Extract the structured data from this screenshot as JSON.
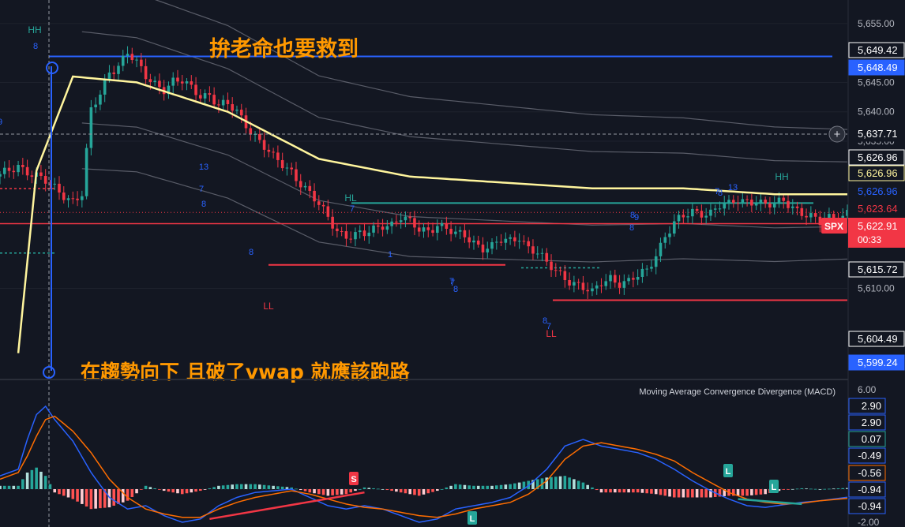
{
  "annotations": {
    "top_text": "拚老命也要救到",
    "bottom_text": "在趨勢向下 且破了vwap 就應該跑路"
  },
  "markers": {
    "hh_left": "HH",
    "hh_right": "HH",
    "hl": "HL",
    "ll_left": "LL",
    "ll_right": "LL",
    "seq": [
      "8",
      "13",
      "7",
      "8",
      "7",
      "8",
      "7",
      "1",
      "8",
      "7",
      "8",
      "7",
      "8",
      "9",
      "8",
      "13",
      "7",
      "8",
      "9"
    ]
  },
  "symbol": {
    "ticker": "SPX",
    "price": "5,622.91",
    "countdown": "00:33"
  },
  "price_axis": {
    "ticks": [
      "5,655.00",
      "5,645.00",
      "5,640.00",
      "5,635.00",
      "5,610.00"
    ],
    "labels": [
      {
        "text": "5,649.42",
        "value": 5649.42,
        "bg": "#131722",
        "fg": "#ffffff",
        "border": "#ffffff"
      },
      {
        "text": "5,648.49",
        "value": 5648.49,
        "bg": "#2962ff",
        "fg": "#ffffff",
        "border": "#2962ff"
      },
      {
        "text": "5,637.71",
        "value": 5637.71,
        "bg": "#131722",
        "fg": "#ffffff",
        "border": "#131722"
      },
      {
        "text": "5,626.96",
        "value": 5626.96,
        "bg": "#131722",
        "fg": "#ffffff",
        "border": "#ffffff"
      },
      {
        "text": "5,626.96",
        "value": 5626.96,
        "bg": "#131722",
        "fg": "#fff59d",
        "border": "#fff59d"
      },
      {
        "text": "5,626.96",
        "value": 5626.96,
        "bg": "#131722",
        "fg": "#2962ff",
        "border": "#131722"
      },
      {
        "text": "5,623.64",
        "value": 5623.64,
        "bg": "#131722",
        "fg": "#f23645",
        "border": "#131722"
      },
      {
        "text": "5,615.72",
        "value": 5615.72,
        "bg": "#131722",
        "fg": "#ffffff",
        "border": "#ffffff"
      },
      {
        "text": "5,604.49",
        "value": 5604.49,
        "bg": "#131722",
        "fg": "#ffffff",
        "border": "#ffffff"
      },
      {
        "text": "5,599.24",
        "value": 5599.24,
        "bg": "#2962ff",
        "fg": "#ffffff",
        "border": "#2962ff"
      }
    ]
  },
  "macd": {
    "title": "Moving Average Convergence Divergence (MACD)",
    "ticks": [
      "6.00",
      "-2.00"
    ],
    "labels": [
      {
        "text": "2.90",
        "fg": "#2962ff"
      },
      {
        "text": "2.90",
        "fg": "#2962ff"
      },
      {
        "text": "0.07",
        "fg": "#26a69a"
      },
      {
        "text": "-0.49",
        "fg": "#2962ff"
      },
      {
        "text": "-0.56",
        "fg": "#ff6d00"
      },
      {
        "text": "-0.94",
        "fg": "#2962ff"
      },
      {
        "text": "-0.94",
        "fg": "#2962ff"
      }
    ],
    "badges": [
      "L",
      "L",
      "L",
      "S"
    ]
  },
  "colors": {
    "background": "#131722",
    "up": "#26a69a",
    "down": "#f23645",
    "vwap": "#fff59d",
    "blue": "#2962ff",
    "annotation": "#ff9800",
    "band": "#787b86"
  },
  "chart_data": {
    "type": "candlestick",
    "y_range": [
      5596,
      5659
    ],
    "macd_range": [
      -2,
      6
    ],
    "close_path": [
      [
        0,
        5629
      ],
      [
        2,
        5630
      ],
      [
        4,
        5631
      ],
      [
        6,
        5630
      ],
      [
        8,
        5629
      ],
      [
        10,
        5628
      ],
      [
        12,
        5627
      ],
      [
        14,
        5626
      ],
      [
        16,
        5625
      ],
      [
        18,
        5626
      ],
      [
        20,
        5640
      ],
      [
        22,
        5643
      ],
      [
        24,
        5647
      ],
      [
        26,
        5648
      ],
      [
        28,
        5650
      ],
      [
        30,
        5648
      ],
      [
        32,
        5646
      ],
      [
        34,
        5645
      ],
      [
        36,
        5644
      ],
      [
        38,
        5645
      ],
      [
        40,
        5645
      ],
      [
        42,
        5644
      ],
      [
        44,
        5643
      ],
      [
        46,
        5643
      ],
      [
        48,
        5641
      ],
      [
        50,
        5641
      ],
      [
        52,
        5640
      ],
      [
        54,
        5638
      ],
      [
        56,
        5636
      ],
      [
        58,
        5634
      ],
      [
        60,
        5632
      ],
      [
        62,
        5631
      ],
      [
        64,
        5630
      ],
      [
        66,
        5628
      ],
      [
        68,
        5626
      ],
      [
        70,
        5624
      ],
      [
        72,
        5622
      ],
      [
        74,
        5620
      ],
      [
        76,
        5619
      ],
      [
        78,
        5619
      ],
      [
        80,
        5619
      ],
      [
        82,
        5620
      ],
      [
        84,
        5621
      ],
      [
        86,
        5621
      ],
      [
        88,
        5622
      ],
      [
        90,
        5621
      ],
      [
        92,
        5620
      ],
      [
        94,
        5620
      ],
      [
        96,
        5621
      ],
      [
        98,
        5620
      ],
      [
        100,
        5619
      ],
      [
        102,
        5619
      ],
      [
        104,
        5618
      ],
      [
        106,
        5617
      ],
      [
        108,
        5617
      ],
      [
        110,
        5618
      ],
      [
        112,
        5618
      ],
      [
        114,
        5619
      ],
      [
        116,
        5617
      ],
      [
        118,
        5616
      ],
      [
        120,
        5614
      ],
      [
        122,
        5613
      ],
      [
        124,
        5612
      ],
      [
        126,
        5611
      ],
      [
        128,
        5610
      ],
      [
        130,
        5609
      ],
      [
        132,
        5611
      ],
      [
        134,
        5612
      ],
      [
        136,
        5611
      ],
      [
        138,
        5611
      ],
      [
        140,
        5612
      ],
      [
        142,
        5613
      ],
      [
        144,
        5616
      ],
      [
        146,
        5619
      ],
      [
        148,
        5621
      ],
      [
        150,
        5622
      ],
      [
        152,
        5623
      ],
      [
        154,
        5623
      ],
      [
        156,
        5623
      ],
      [
        158,
        5624
      ],
      [
        160,
        5624
      ],
      [
        162,
        5625
      ],
      [
        164,
        5625
      ],
      [
        166,
        5625
      ],
      [
        168,
        5624
      ],
      [
        170,
        5624
      ],
      [
        172,
        5625
      ],
      [
        174,
        5624
      ],
      [
        176,
        5623
      ],
      [
        178,
        5622
      ],
      [
        180,
        5621
      ],
      [
        182,
        5622
      ],
      [
        184,
        5622
      ],
      [
        186,
        5623
      ]
    ],
    "vwap_path": [
      [
        4,
        5599
      ],
      [
        8,
        5630
      ],
      [
        16,
        5646
      ],
      [
        30,
        5645
      ],
      [
        50,
        5640
      ],
      [
        70,
        5632
      ],
      [
        90,
        5629
      ],
      [
        110,
        5628
      ],
      [
        130,
        5627
      ],
      [
        150,
        5627
      ],
      [
        170,
        5626
      ],
      [
        186,
        5626
      ]
    ],
    "macd_path": [
      [
        0,
        0.8
      ],
      [
        4,
        1.2
      ],
      [
        6,
        3.0
      ],
      [
        8,
        4.5
      ],
      [
        10,
        5.0
      ],
      [
        12,
        4.2
      ],
      [
        16,
        2.9
      ],
      [
        20,
        1.0
      ],
      [
        24,
        -0.5
      ],
      [
        28,
        -1.2
      ],
      [
        32,
        -1.0
      ],
      [
        36,
        -1.6
      ],
      [
        40,
        -2.0
      ],
      [
        44,
        -1.8
      ],
      [
        48,
        -1.0
      ],
      [
        52,
        -0.5
      ],
      [
        56,
        -0.2
      ],
      [
        60,
        -0.1
      ],
      [
        64,
        0.0
      ],
      [
        68,
        -0.5
      ],
      [
        72,
        -1.0
      ],
      [
        76,
        -1.2
      ],
      [
        80,
        -1.0
      ],
      [
        84,
        -1.2
      ],
      [
        88,
        -1.6
      ],
      [
        92,
        -2.0
      ],
      [
        96,
        -1.8
      ],
      [
        100,
        -1.2
      ],
      [
        104,
        -1.0
      ],
      [
        108,
        -0.8
      ],
      [
        112,
        -0.5
      ],
      [
        116,
        0.2
      ],
      [
        120,
        1.2
      ],
      [
        124,
        2.6
      ],
      [
        128,
        3.0
      ],
      [
        132,
        2.6
      ],
      [
        136,
        2.4
      ],
      [
        140,
        2.2
      ],
      [
        144,
        1.8
      ],
      [
        148,
        1.2
      ],
      [
        152,
        0.5
      ],
      [
        156,
        -0.1
      ],
      [
        160,
        -0.6
      ],
      [
        164,
        -1.0
      ],
      [
        168,
        -1.1
      ],
      [
        172,
        -0.94
      ],
      [
        176,
        -0.8
      ],
      [
        180,
        -0.7
      ],
      [
        186,
        -0.49
      ]
    ],
    "signal_path": [
      [
        0,
        0.6
      ],
      [
        4,
        1.0
      ],
      [
        6,
        2.0
      ],
      [
        8,
        3.2
      ],
      [
        10,
        4.2
      ],
      [
        12,
        4.4
      ],
      [
        16,
        3.5
      ],
      [
        20,
        2.2
      ],
      [
        24,
        0.6
      ],
      [
        28,
        -0.5
      ],
      [
        32,
        -1.2
      ],
      [
        36,
        -1.5
      ],
      [
        40,
        -1.7
      ],
      [
        44,
        -1.7
      ],
      [
        48,
        -1.2
      ],
      [
        52,
        -0.8
      ],
      [
        56,
        -0.5
      ],
      [
        60,
        -0.3
      ],
      [
        64,
        -0.1
      ],
      [
        68,
        -0.3
      ],
      [
        72,
        -0.6
      ],
      [
        76,
        -0.9
      ],
      [
        80,
        -1.1
      ],
      [
        84,
        -1.2
      ],
      [
        88,
        -1.4
      ],
      [
        92,
        -1.6
      ],
      [
        96,
        -1.7
      ],
      [
        100,
        -1.5
      ],
      [
        104,
        -1.2
      ],
      [
        108,
        -1.0
      ],
      [
        112,
        -0.8
      ],
      [
        116,
        -0.3
      ],
      [
        120,
        0.5
      ],
      [
        124,
        1.8
      ],
      [
        128,
        2.6
      ],
      [
        132,
        2.8
      ],
      [
        136,
        2.6
      ],
      [
        140,
        2.4
      ],
      [
        144,
        2.1
      ],
      [
        148,
        1.7
      ],
      [
        152,
        1.0
      ],
      [
        156,
        0.4
      ],
      [
        160,
        -0.2
      ],
      [
        164,
        -0.6
      ],
      [
        168,
        -0.8
      ],
      [
        172,
        -0.9
      ],
      [
        176,
        -0.85
      ],
      [
        180,
        -0.7
      ],
      [
        186,
        -0.56
      ]
    ]
  }
}
